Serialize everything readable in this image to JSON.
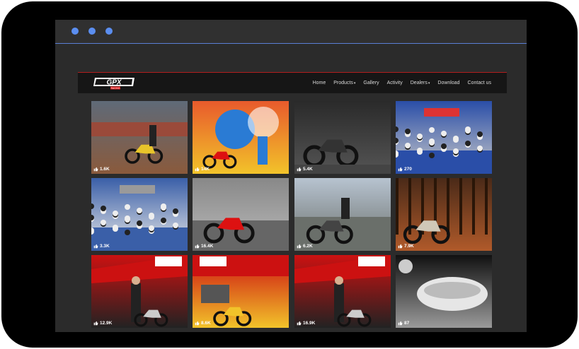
{
  "brand": {
    "name": "GPX",
    "sub": "RACING"
  },
  "nav": {
    "home": "Home",
    "products": "Products",
    "gallery": "Gallery",
    "activity": "Activity",
    "dealers": "Dealers",
    "download": "Download",
    "contact": "Contact us"
  },
  "tiles": [
    {
      "likes": "1.6K",
      "scene": "stadium",
      "colors": [
        "#5f6a78",
        "#8a5a3c",
        "#c79a7a"
      ]
    },
    {
      "likes": "14K",
      "scene": "graffiti",
      "colors": [
        "#e85a2c",
        "#f2c32a",
        "#2a7bd4"
      ]
    },
    {
      "likes": "5.4K",
      "scene": "dark-bike",
      "colors": [
        "#2a2a2a",
        "#555",
        "#c11"
      ]
    },
    {
      "likes": "270",
      "scene": "crowd-blue",
      "colors": [
        "#2a4ea8",
        "#c9c9c9",
        "#d33"
      ]
    },
    {
      "likes": "3.3K",
      "scene": "crowd-hall",
      "colors": [
        "#3a5fa8",
        "#e8e8e8",
        "#9a9a9a"
      ]
    },
    {
      "likes": "16.4K",
      "scene": "red-bike-bw",
      "colors": [
        "#888",
        "#bbb",
        "#d11"
      ]
    },
    {
      "likes": "6.2K",
      "scene": "rider-blur",
      "colors": [
        "#b7c3d0",
        "#6a6f6a",
        "#3b3b3b"
      ]
    },
    {
      "likes": "7.9K",
      "scene": "forest-bike",
      "colors": [
        "#4a2a18",
        "#b05a2a",
        "#d0c8b8"
      ]
    },
    {
      "likes": "12.9K",
      "scene": "booth-model",
      "colors": [
        "#c11",
        "#222",
        "#eee"
      ]
    },
    {
      "likes": "8.6K",
      "scene": "booth-yellow",
      "colors": [
        "#c11",
        "#f2c32a",
        "#eee"
      ]
    },
    {
      "likes": "16.9K",
      "scene": "booth-model2",
      "colors": [
        "#c11",
        "#222",
        "#eee"
      ]
    },
    {
      "likes": "87",
      "scene": "chrome-tank",
      "colors": [
        "#111",
        "#9a9a9a",
        "#e6e6e6"
      ]
    }
  ]
}
